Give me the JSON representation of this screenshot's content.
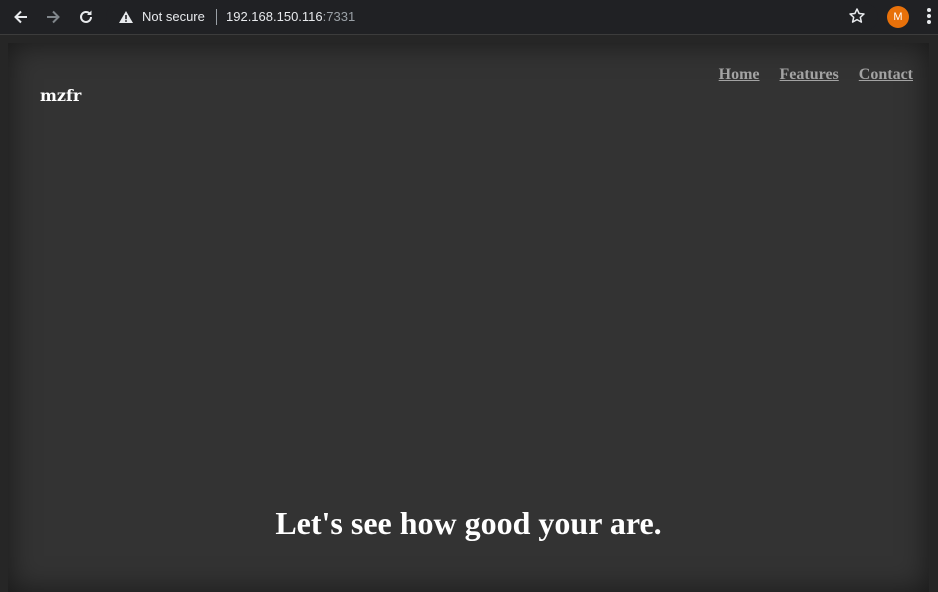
{
  "browser": {
    "security_label": "Not secure",
    "url_host": "192.168.150.116",
    "url_port": ":7331",
    "profile_initial": "M",
    "profile_color": "#e8710a"
  },
  "site": {
    "brand": "mzfr",
    "nav": [
      "Home",
      "Features",
      "Contact"
    ],
    "heading": "Let's see how good your are."
  }
}
